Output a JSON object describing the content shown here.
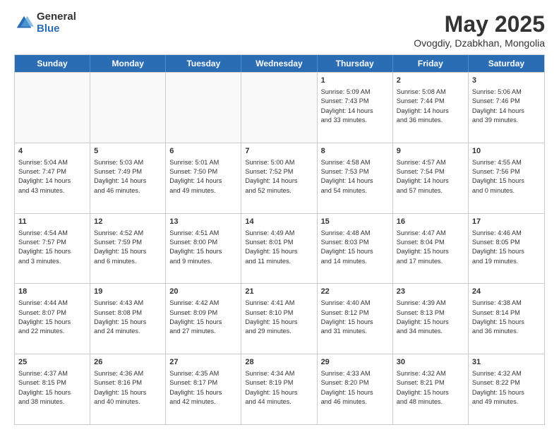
{
  "logo": {
    "general": "General",
    "blue": "Blue"
  },
  "title": "May 2025",
  "location": "Ovogdiy, Dzabkhan, Mongolia",
  "headers": [
    "Sunday",
    "Monday",
    "Tuesday",
    "Wednesday",
    "Thursday",
    "Friday",
    "Saturday"
  ],
  "rows": [
    [
      {
        "day": "",
        "info": "",
        "empty": true
      },
      {
        "day": "",
        "info": "",
        "empty": true
      },
      {
        "day": "",
        "info": "",
        "empty": true
      },
      {
        "day": "",
        "info": "",
        "empty": true
      },
      {
        "day": "1",
        "info": "Sunrise: 5:09 AM\nSunset: 7:43 PM\nDaylight: 14 hours\nand 33 minutes.",
        "empty": false
      },
      {
        "day": "2",
        "info": "Sunrise: 5:08 AM\nSunset: 7:44 PM\nDaylight: 14 hours\nand 36 minutes.",
        "empty": false
      },
      {
        "day": "3",
        "info": "Sunrise: 5:06 AM\nSunset: 7:46 PM\nDaylight: 14 hours\nand 39 minutes.",
        "empty": false
      }
    ],
    [
      {
        "day": "4",
        "info": "Sunrise: 5:04 AM\nSunset: 7:47 PM\nDaylight: 14 hours\nand 43 minutes.",
        "empty": false
      },
      {
        "day": "5",
        "info": "Sunrise: 5:03 AM\nSunset: 7:49 PM\nDaylight: 14 hours\nand 46 minutes.",
        "empty": false
      },
      {
        "day": "6",
        "info": "Sunrise: 5:01 AM\nSunset: 7:50 PM\nDaylight: 14 hours\nand 49 minutes.",
        "empty": false
      },
      {
        "day": "7",
        "info": "Sunrise: 5:00 AM\nSunset: 7:52 PM\nDaylight: 14 hours\nand 52 minutes.",
        "empty": false
      },
      {
        "day": "8",
        "info": "Sunrise: 4:58 AM\nSunset: 7:53 PM\nDaylight: 14 hours\nand 54 minutes.",
        "empty": false
      },
      {
        "day": "9",
        "info": "Sunrise: 4:57 AM\nSunset: 7:54 PM\nDaylight: 14 hours\nand 57 minutes.",
        "empty": false
      },
      {
        "day": "10",
        "info": "Sunrise: 4:55 AM\nSunset: 7:56 PM\nDaylight: 15 hours\nand 0 minutes.",
        "empty": false
      }
    ],
    [
      {
        "day": "11",
        "info": "Sunrise: 4:54 AM\nSunset: 7:57 PM\nDaylight: 15 hours\nand 3 minutes.",
        "empty": false
      },
      {
        "day": "12",
        "info": "Sunrise: 4:52 AM\nSunset: 7:59 PM\nDaylight: 15 hours\nand 6 minutes.",
        "empty": false
      },
      {
        "day": "13",
        "info": "Sunrise: 4:51 AM\nSunset: 8:00 PM\nDaylight: 15 hours\nand 9 minutes.",
        "empty": false
      },
      {
        "day": "14",
        "info": "Sunrise: 4:49 AM\nSunset: 8:01 PM\nDaylight: 15 hours\nand 11 minutes.",
        "empty": false
      },
      {
        "day": "15",
        "info": "Sunrise: 4:48 AM\nSunset: 8:03 PM\nDaylight: 15 hours\nand 14 minutes.",
        "empty": false
      },
      {
        "day": "16",
        "info": "Sunrise: 4:47 AM\nSunset: 8:04 PM\nDaylight: 15 hours\nand 17 minutes.",
        "empty": false
      },
      {
        "day": "17",
        "info": "Sunrise: 4:46 AM\nSunset: 8:05 PM\nDaylight: 15 hours\nand 19 minutes.",
        "empty": false
      }
    ],
    [
      {
        "day": "18",
        "info": "Sunrise: 4:44 AM\nSunset: 8:07 PM\nDaylight: 15 hours\nand 22 minutes.",
        "empty": false
      },
      {
        "day": "19",
        "info": "Sunrise: 4:43 AM\nSunset: 8:08 PM\nDaylight: 15 hours\nand 24 minutes.",
        "empty": false
      },
      {
        "day": "20",
        "info": "Sunrise: 4:42 AM\nSunset: 8:09 PM\nDaylight: 15 hours\nand 27 minutes.",
        "empty": false
      },
      {
        "day": "21",
        "info": "Sunrise: 4:41 AM\nSunset: 8:10 PM\nDaylight: 15 hours\nand 29 minutes.",
        "empty": false
      },
      {
        "day": "22",
        "info": "Sunrise: 4:40 AM\nSunset: 8:12 PM\nDaylight: 15 hours\nand 31 minutes.",
        "empty": false
      },
      {
        "day": "23",
        "info": "Sunrise: 4:39 AM\nSunset: 8:13 PM\nDaylight: 15 hours\nand 34 minutes.",
        "empty": false
      },
      {
        "day": "24",
        "info": "Sunrise: 4:38 AM\nSunset: 8:14 PM\nDaylight: 15 hours\nand 36 minutes.",
        "empty": false
      }
    ],
    [
      {
        "day": "25",
        "info": "Sunrise: 4:37 AM\nSunset: 8:15 PM\nDaylight: 15 hours\nand 38 minutes.",
        "empty": false
      },
      {
        "day": "26",
        "info": "Sunrise: 4:36 AM\nSunset: 8:16 PM\nDaylight: 15 hours\nand 40 minutes.",
        "empty": false
      },
      {
        "day": "27",
        "info": "Sunrise: 4:35 AM\nSunset: 8:17 PM\nDaylight: 15 hours\nand 42 minutes.",
        "empty": false
      },
      {
        "day": "28",
        "info": "Sunrise: 4:34 AM\nSunset: 8:19 PM\nDaylight: 15 hours\nand 44 minutes.",
        "empty": false
      },
      {
        "day": "29",
        "info": "Sunrise: 4:33 AM\nSunset: 8:20 PM\nDaylight: 15 hours\nand 46 minutes.",
        "empty": false
      },
      {
        "day": "30",
        "info": "Sunrise: 4:32 AM\nSunset: 8:21 PM\nDaylight: 15 hours\nand 48 minutes.",
        "empty": false
      },
      {
        "day": "31",
        "info": "Sunrise: 4:32 AM\nSunset: 8:22 PM\nDaylight: 15 hours\nand 49 minutes.",
        "empty": false
      }
    ]
  ]
}
